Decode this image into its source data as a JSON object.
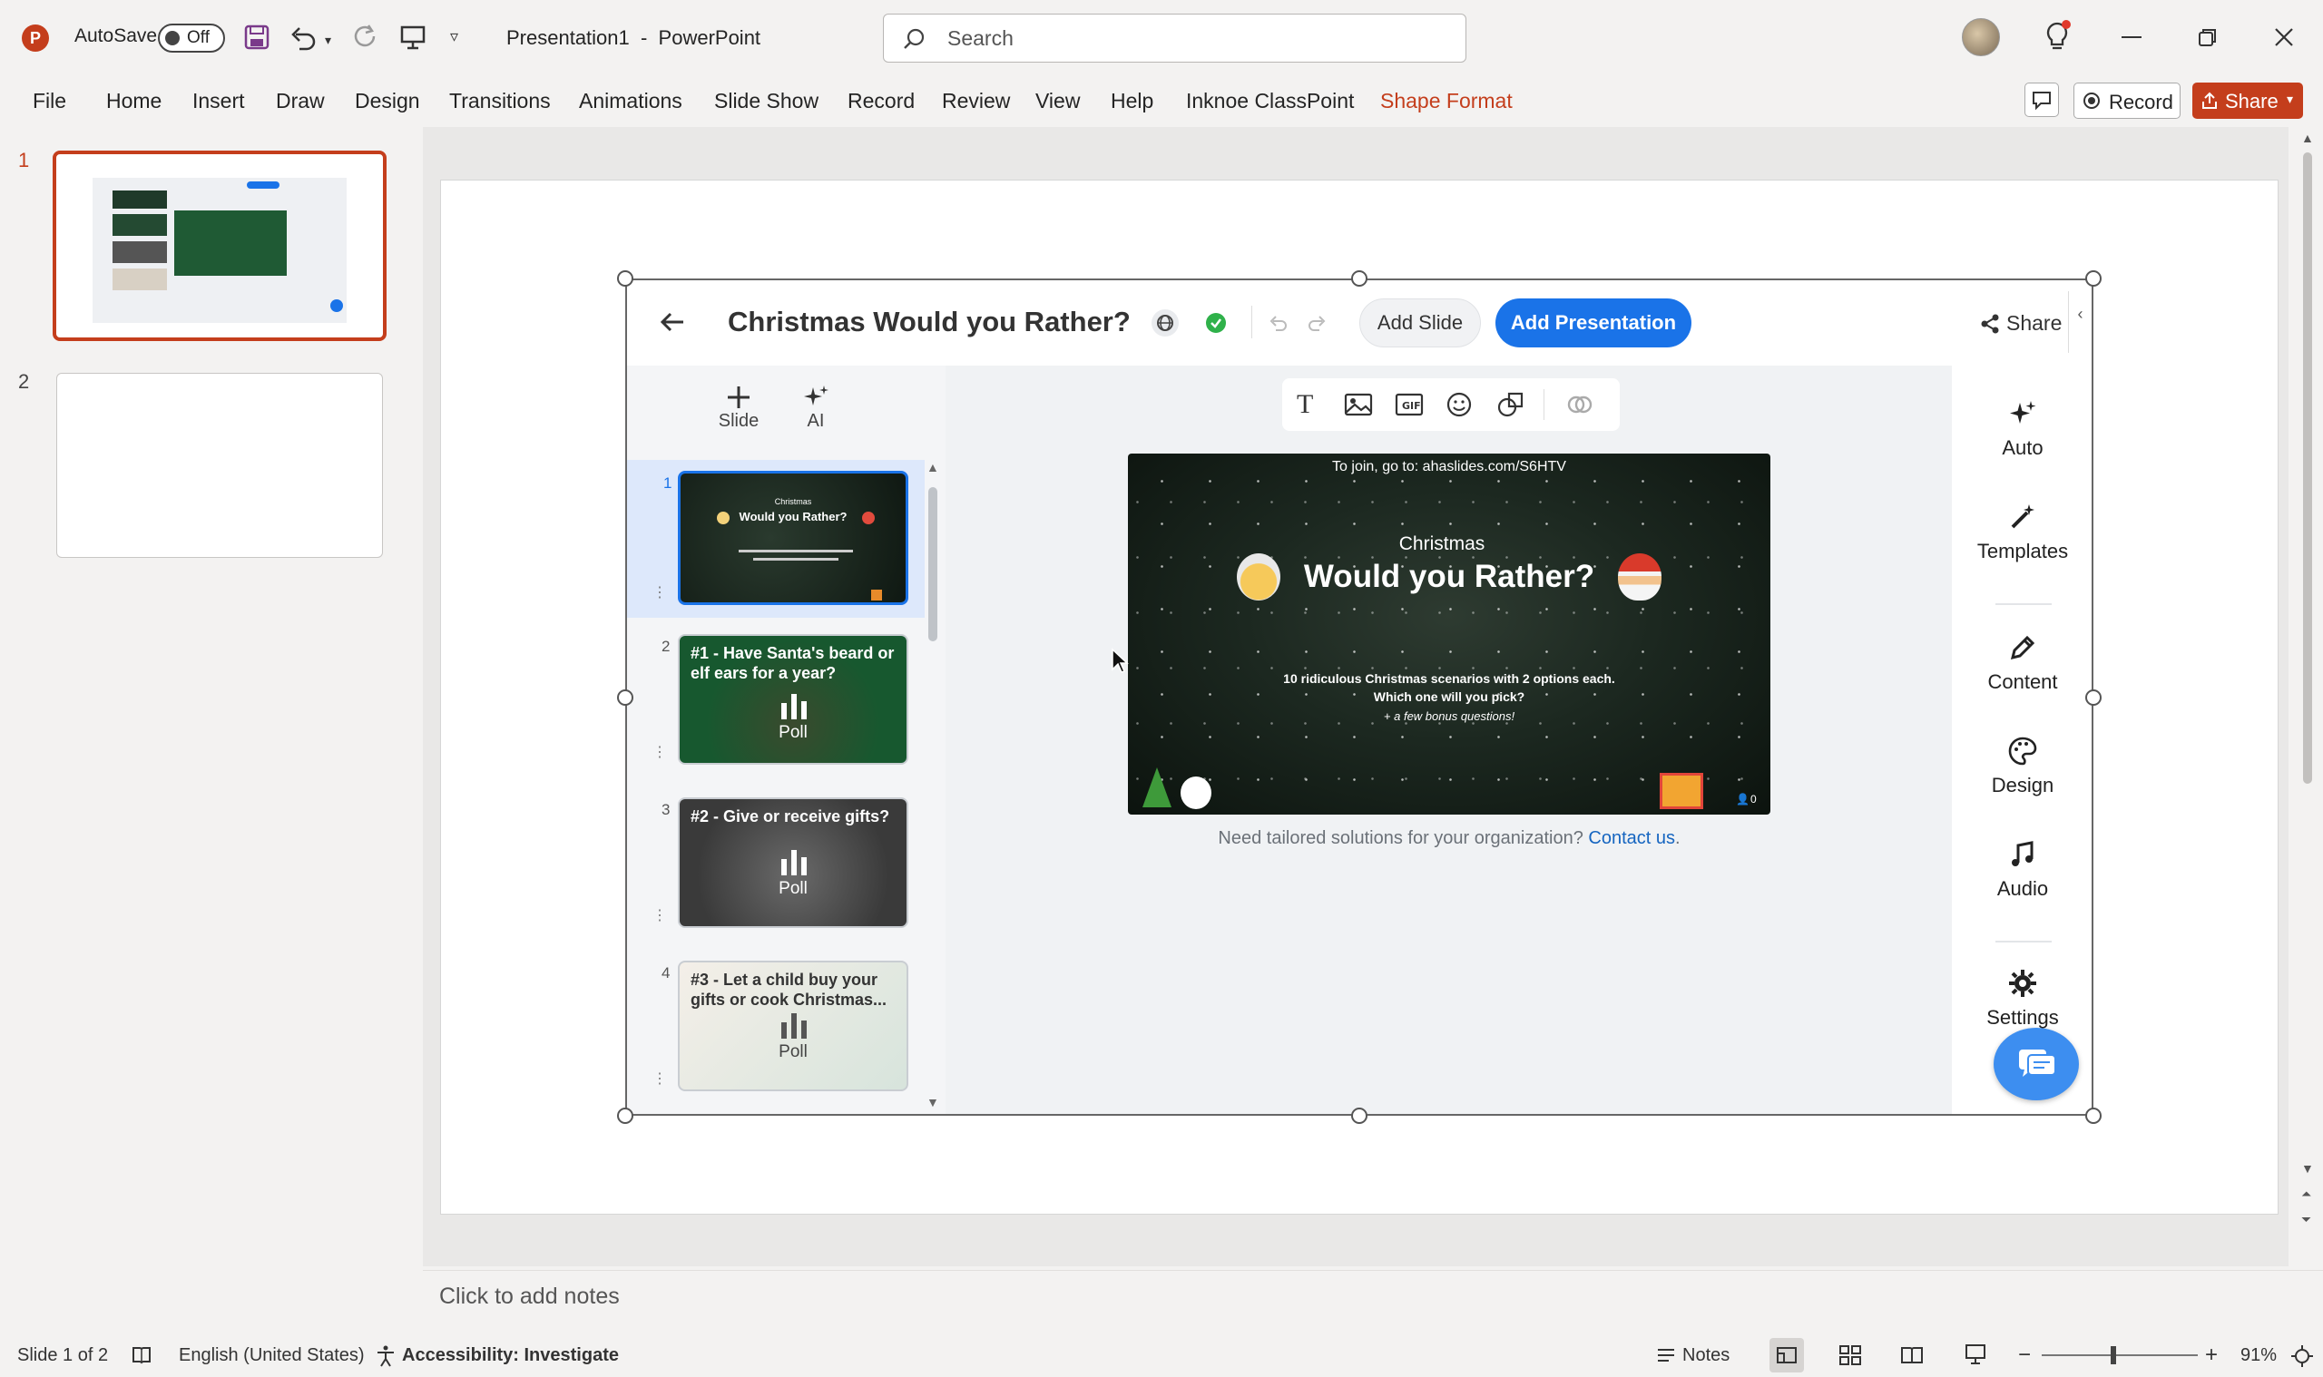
{
  "titlebar": {
    "autosave_label": "AutoSave",
    "autosave_state": "Off",
    "doc_title": "Presentation1  -  PowerPoint",
    "search_placeholder": "Search"
  },
  "ribbon": {
    "tabs": [
      "File",
      "Home",
      "Insert",
      "Draw",
      "Design",
      "Transitions",
      "Animations",
      "Slide Show",
      "Record",
      "Review",
      "View",
      "Help",
      "Inknoe ClassPoint",
      "Shape Format"
    ],
    "record_label": "Record",
    "share_label": "Share"
  },
  "thumbnails": [
    {
      "number": "1"
    },
    {
      "number": "2"
    }
  ],
  "app": {
    "title": "Christmas Would you Rather?",
    "add_slide": "Add Slide",
    "add_presentation": "Add Presentation",
    "share": "Share",
    "side_tools": [
      {
        "label": "Slide"
      },
      {
        "label": "AI"
      }
    ],
    "slides": [
      {
        "number": "1",
        "title": "Christmas",
        "subtitle": "Would you Rather?"
      },
      {
        "number": "2",
        "title": "#1 - Have Santa's beard or elf ears for a year?",
        "badge": "Poll"
      },
      {
        "number": "3",
        "title": "#2 - Give or receive gifts?",
        "badge": "Poll"
      },
      {
        "number": "4",
        "title": "#3 - Let a child buy your gifts or cook Christmas...",
        "badge": "Poll"
      }
    ],
    "preview": {
      "join_text": "To join, go to: ahaslides.com/S6HTV",
      "kicker": "Christmas",
      "headline": "Would you Rather?",
      "line1": "10 ridiculous Christmas scenarios with 2 options each.",
      "line2": "Which one will you pick?",
      "line3": "+ a few bonus questions!",
      "count": "0"
    },
    "footer_text": "Need tailored solutions for your organization?",
    "footer_link": "Contact us",
    "footer_end": ".",
    "right_tools": [
      {
        "label": "Auto"
      },
      {
        "label": "Templates"
      },
      {
        "label": "Content"
      },
      {
        "label": "Design"
      },
      {
        "label": "Audio"
      },
      {
        "label": "Settings"
      }
    ]
  },
  "notes_placeholder": "Click to add notes",
  "status": {
    "slide_info": "Slide 1 of 2",
    "language": "English (United States)",
    "accessibility": "Accessibility: Investigate",
    "notes": "Notes",
    "zoom": "91%"
  },
  "colors": {
    "accent": "#c43e1c",
    "app_blue": "#1a73e8",
    "link_blue": "#1565c0"
  }
}
